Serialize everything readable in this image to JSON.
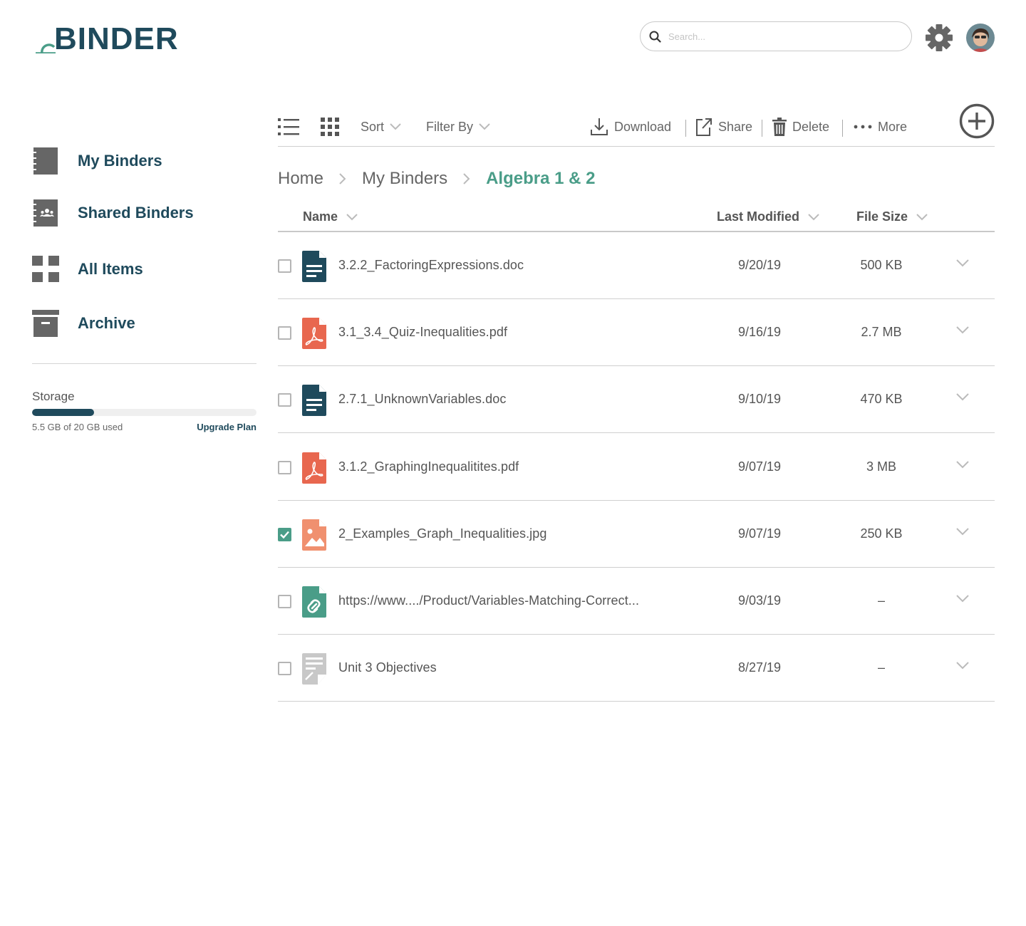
{
  "app": {
    "logo_text": "BINDER"
  },
  "search": {
    "placeholder": "Search..."
  },
  "sidebar": {
    "items": [
      {
        "label": "My Binders"
      },
      {
        "label": "Shared Binders"
      },
      {
        "label": "All Items"
      },
      {
        "label": "Archive"
      }
    ],
    "storage": {
      "title": "Storage",
      "used_text": "5.5 GB of 20 GB used",
      "used_fraction": 0.275,
      "upgrade_label": "Upgrade Plan"
    }
  },
  "toolbar": {
    "sort_label": "Sort",
    "filter_label": "Filter By",
    "download_label": "Download",
    "share_label": "Share",
    "delete_label": "Delete",
    "more_label": "More"
  },
  "breadcrumb": {
    "items": [
      "Home",
      "My Binders"
    ],
    "current": "Algebra 1 & 2"
  },
  "table": {
    "columns": {
      "name": "Name",
      "modified": "Last Modified",
      "size": "File Size"
    },
    "rows": [
      {
        "name": "3.2.2_FactoringExpressions.doc",
        "modified": "9/20/19",
        "size": "500 KB",
        "type": "doc",
        "checked": false
      },
      {
        "name": "3.1_3.4_Quiz-Inequalities.pdf",
        "modified": "9/16/19",
        "size": "2.7 MB",
        "type": "pdf",
        "checked": false
      },
      {
        "name": "2.7.1_UnknownVariables.doc",
        "modified": "9/10/19",
        "size": "470 KB",
        "type": "doc",
        "checked": false
      },
      {
        "name": "3.1.2_GraphingInequalitites.pdf",
        "modified": "9/07/19",
        "size": "3 MB",
        "type": "pdf",
        "checked": false
      },
      {
        "name": "2_Examples_Graph_Inequalities.jpg",
        "modified": "9/07/19",
        "size": "250 KB",
        "type": "image",
        "checked": true
      },
      {
        "name": "https://www..../Product/Variables-Matching-Correct...",
        "modified": "9/03/19",
        "size": "–",
        "type": "link",
        "checked": false
      },
      {
        "name": "Unit 3 Objectives",
        "modified": "8/27/19",
        "size": "–",
        "type": "note",
        "checked": false
      }
    ]
  },
  "colors": {
    "brand_dark": "#1f4a5c",
    "accent_green": "#4a9d88",
    "pdf_red": "#e8674f",
    "image_salmon": "#f0906f",
    "note_gray": "#c8c8c8"
  }
}
